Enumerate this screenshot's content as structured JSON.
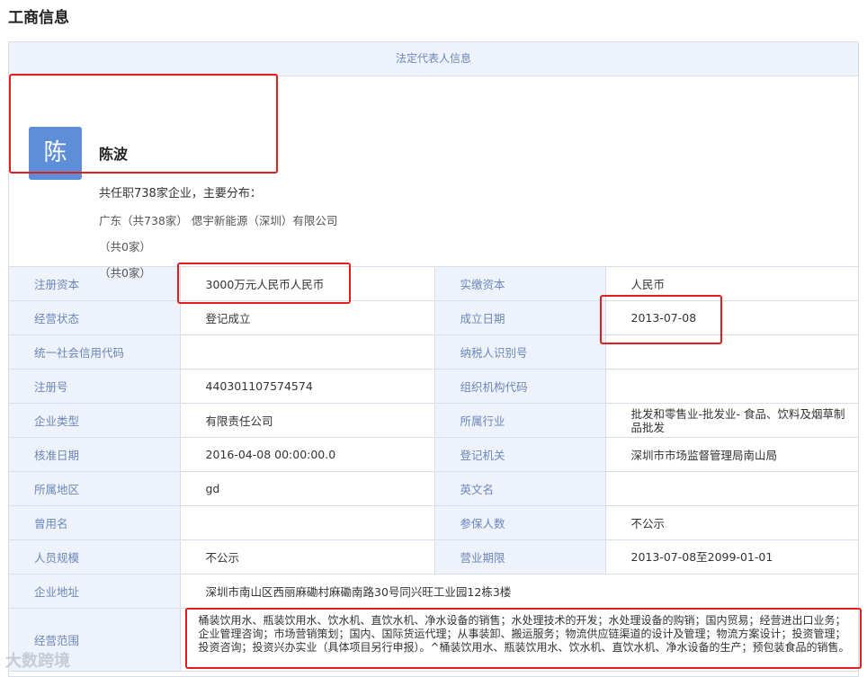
{
  "page_title": "工商信息",
  "section_header": "法定代表人信息",
  "representative": {
    "avatar_char": "陈",
    "name": "陈波",
    "count_text": "共任职738家企业，主要分布：",
    "lines": [
      "广东（共738家） 偲宇新能源（深圳）有限公司",
      "（共0家）",
      "（共0家）"
    ]
  },
  "rows": [
    {
      "l1": "注册资本",
      "v1": "3000万元人民币人民币",
      "l2": "实缴资本",
      "v2": "人民币"
    },
    {
      "l1": "经营状态",
      "v1": "登记成立",
      "l2": "成立日期",
      "v2": "2013-07-08"
    },
    {
      "l1": "统一社会信用代码",
      "v1": "",
      "l2": "纳税人识别号",
      "v2": ""
    },
    {
      "l1": "注册号",
      "v1": "440301107574574",
      "l2": "组织机构代码",
      "v2": ""
    },
    {
      "l1": "企业类型",
      "v1": "有限责任公司",
      "l2": "所属行业",
      "v2": "批发和零售业-批发业- 食品、饮料及烟草制品批发"
    },
    {
      "l1": "核准日期",
      "v1": "2016-04-08 00:00:00.0",
      "l2": "登记机关",
      "v2": "深圳市市场监督管理局南山局"
    },
    {
      "l1": "所属地区",
      "v1": "gd",
      "l2": "英文名",
      "v2": ""
    },
    {
      "l1": "曾用名",
      "v1": "",
      "l2": "参保人数",
      "v2": "不公示"
    },
    {
      "l1": "人员规模",
      "v1": "不公示",
      "l2": "营业期限",
      "v2": "2013-07-08至2099-01-01"
    }
  ],
  "address": {
    "label": "企业地址",
    "value": "深圳市南山区西丽麻磡村麻磡南路30号同兴旺工业园12栋3楼"
  },
  "scope": {
    "label": "经营范围",
    "value": "桶装饮用水、瓶装饮用水、饮水机、直饮水机、净水设备的销售；水处理技术的开发；水处理设备的购销；国内贸易；经营进出口业务；企业管理咨询；市场营销策划；国内、国际货运代理；从事装卸、搬运服务；物流供应链渠道的设计及管理；物流方案设计；投资管理；投资咨询；投资兴办实业（具体项目另行申报）。^桶装饮用水、瓶装饮用水、饮水机、直饮水机、净水设备的生产；预包装食品的销售。"
  },
  "watermark": "大数跨境",
  "colors": {
    "highlight": "#e02020",
    "label_bg": "#eef3fb",
    "label_text": "#6b86b8",
    "avatar": "#5f8ed8"
  }
}
